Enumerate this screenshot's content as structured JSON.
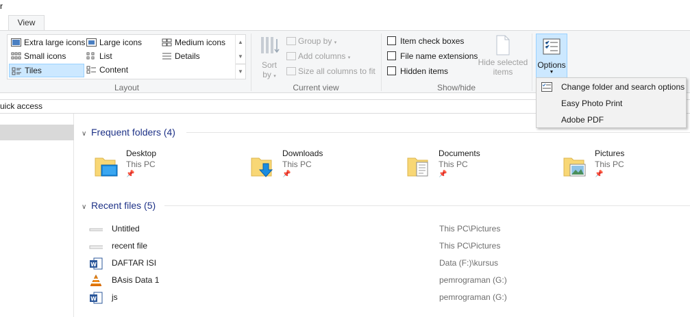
{
  "window": {
    "title_fragment": "r"
  },
  "ribbon": {
    "active_tab": "View",
    "layout": {
      "group_label": "Layout",
      "items": [
        {
          "label": "Extra large icons"
        },
        {
          "label": "Large icons"
        },
        {
          "label": "Medium icons"
        },
        {
          "label": "Small icons"
        },
        {
          "label": "List"
        },
        {
          "label": "Details"
        },
        {
          "label": "Tiles"
        },
        {
          "label": "Content"
        }
      ],
      "selected": "Tiles"
    },
    "current_view": {
      "group_label": "Current view",
      "sort_label": "Sort",
      "sort_by_label": "by",
      "group_by": "Group by",
      "add_columns": "Add columns",
      "size_columns": "Size all columns to fit"
    },
    "show_hide": {
      "group_label": "Show/hide",
      "item_check_boxes": {
        "label": "Item check boxes",
        "checked": false
      },
      "file_name_extensions": {
        "label": "File name extensions",
        "checked": false
      },
      "hidden_items": {
        "label": "Hidden items",
        "checked": false
      },
      "hide_selected_line1": "Hide selected",
      "hide_selected_line2": "items"
    },
    "options_label": "Options"
  },
  "options_menu": {
    "items": [
      {
        "label": "Change folder and search options"
      },
      {
        "label": "Easy Photo Print"
      },
      {
        "label": "Adobe PDF"
      }
    ]
  },
  "address": {
    "text": "uick access"
  },
  "frequent": {
    "header": "Frequent folders (4)",
    "folders": [
      {
        "name": "Desktop",
        "location": "This PC"
      },
      {
        "name": "Downloads",
        "location": "This PC"
      },
      {
        "name": "Documents",
        "location": "This PC"
      },
      {
        "name": "Pictures",
        "location": "This PC"
      }
    ]
  },
  "recent": {
    "header": "Recent files (5)",
    "files": [
      {
        "name": "Untitled",
        "location": "This PC\\Pictures",
        "icon": "image-file-icon"
      },
      {
        "name": "recent file",
        "location": "This PC\\Pictures",
        "icon": "image-file-icon"
      },
      {
        "name": "DAFTAR ISI",
        "location": "Data (F:)\\kursus",
        "icon": "word-doc-icon"
      },
      {
        "name": "BAsis Data 1",
        "location": "pemrograman (G:)",
        "icon": "vlc-media-icon"
      },
      {
        "name": "js",
        "location": "pemrograman (G:)",
        "icon": "word-doc-icon"
      }
    ]
  },
  "colors": {
    "accent_selected": "#cce8ff",
    "section_header": "#1e3287",
    "ribbon_bg": "#f5f6f7",
    "folder_yellow": "#f8d775"
  }
}
